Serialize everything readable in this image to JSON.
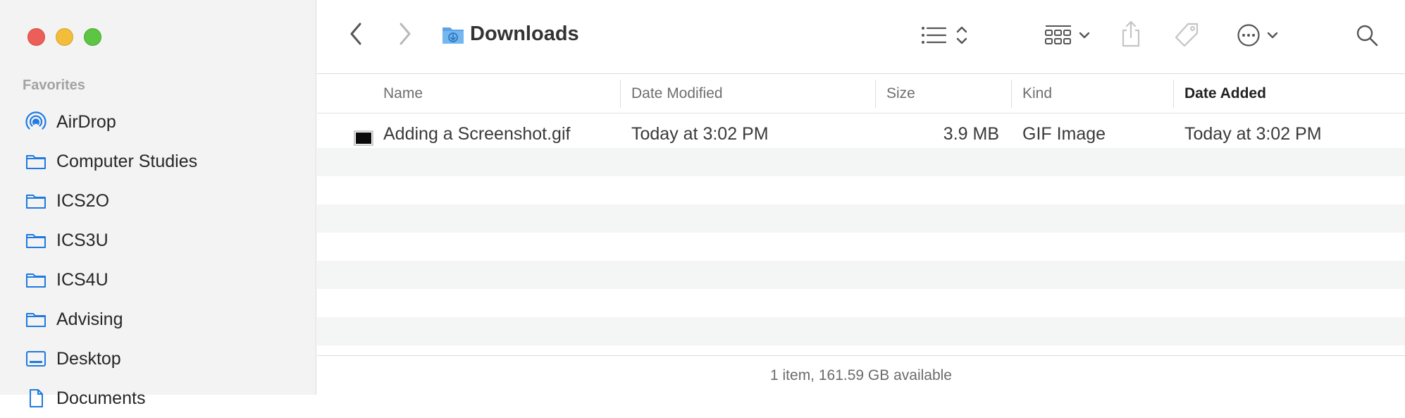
{
  "window": {
    "controls": [
      "close",
      "minimize",
      "zoom"
    ],
    "title": "Downloads"
  },
  "sidebar": {
    "heading": "Favorites",
    "items": [
      {
        "label": "AirDrop",
        "icon": "airdrop-icon"
      },
      {
        "label": "Computer Studies",
        "icon": "folder-icon"
      },
      {
        "label": "ICS2O",
        "icon": "folder-icon"
      },
      {
        "label": "ICS3U",
        "icon": "folder-icon"
      },
      {
        "label": "ICS4U",
        "icon": "folder-icon"
      },
      {
        "label": "Advising",
        "icon": "folder-icon"
      },
      {
        "label": "Desktop",
        "icon": "desktop-icon"
      },
      {
        "label": "Documents",
        "icon": "document-icon"
      }
    ]
  },
  "toolbar": {
    "icons": [
      "back-icon",
      "forward-icon",
      "list-view-icon",
      "group-icon",
      "share-icon",
      "tag-icon",
      "more-icon",
      "search-icon"
    ]
  },
  "columns": {
    "name": "Name",
    "date_modified": "Date Modified",
    "size": "Size",
    "kind": "Kind",
    "date_added": "Date Added",
    "sorted_by": "Date Added"
  },
  "files": [
    {
      "name": "Adding a Screenshot.gif",
      "date_modified": "Today at 3:02 PM",
      "size": "3.9 MB",
      "kind": "GIF Image",
      "date_added": "Today at 3:02 PM"
    }
  ],
  "status": {
    "text": "1 item, 161.59 GB available"
  },
  "colors": {
    "accent_blue": "#3b82f6",
    "sidebar_bg": "#f3f3f3",
    "stripe": "#f4f5f5",
    "close": "#ec5f58",
    "minimize": "#f2bd3b",
    "zoom": "#5dc543"
  }
}
